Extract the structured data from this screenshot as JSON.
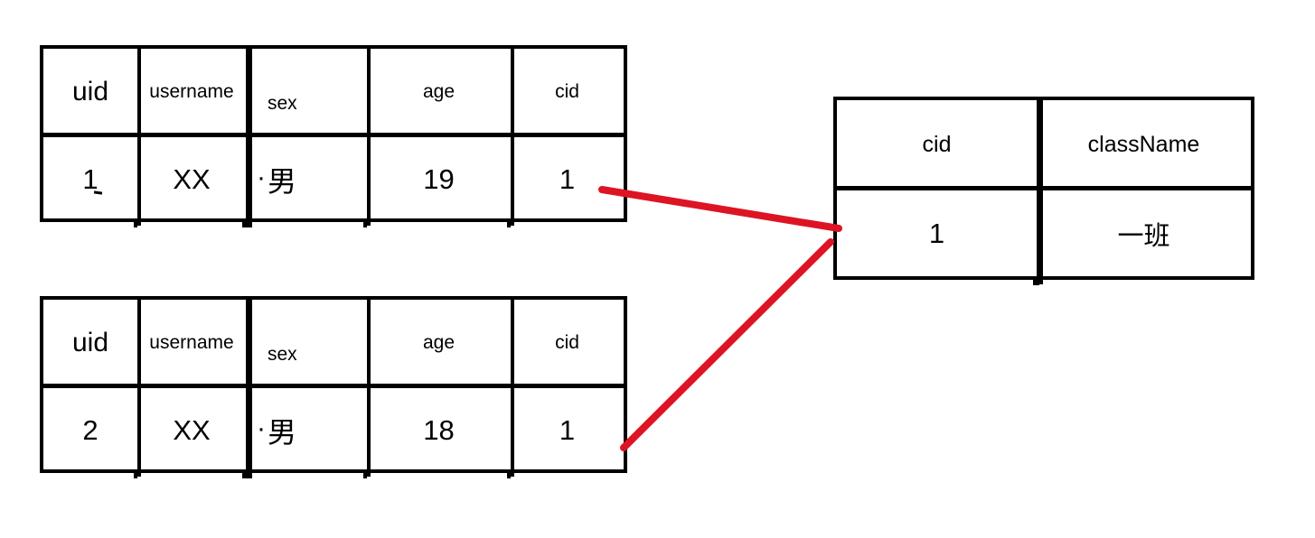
{
  "diagram": {
    "title": "Database table relationship: student tables referencing class table via cid",
    "link_color": "#DD1424",
    "border_color": "#000000",
    "background": "#FFFFFF"
  },
  "student_table_1": {
    "name": "student-table-row1",
    "headers": [
      "uid",
      "username",
      "sex",
      "age",
      "cid"
    ],
    "row": [
      "1",
      "XX",
      "男",
      "19",
      "1"
    ]
  },
  "student_table_2": {
    "name": "student-table-row2",
    "headers": [
      "uid",
      "username",
      "sex",
      "age",
      "cid"
    ],
    "row": [
      "2",
      "XX",
      "男",
      "18",
      "1"
    ]
  },
  "class_table": {
    "name": "class-table",
    "headers": [
      "cid",
      "className"
    ],
    "row": [
      "1",
      "一班"
    ]
  },
  "links": [
    {
      "name": "link-student1-to-class",
      "from": "student_table_1.cid",
      "to": "class_table.cid"
    },
    {
      "name": "link-student2-to-class",
      "from": "student_table_2.cid",
      "to": "class_table.cid"
    }
  ]
}
